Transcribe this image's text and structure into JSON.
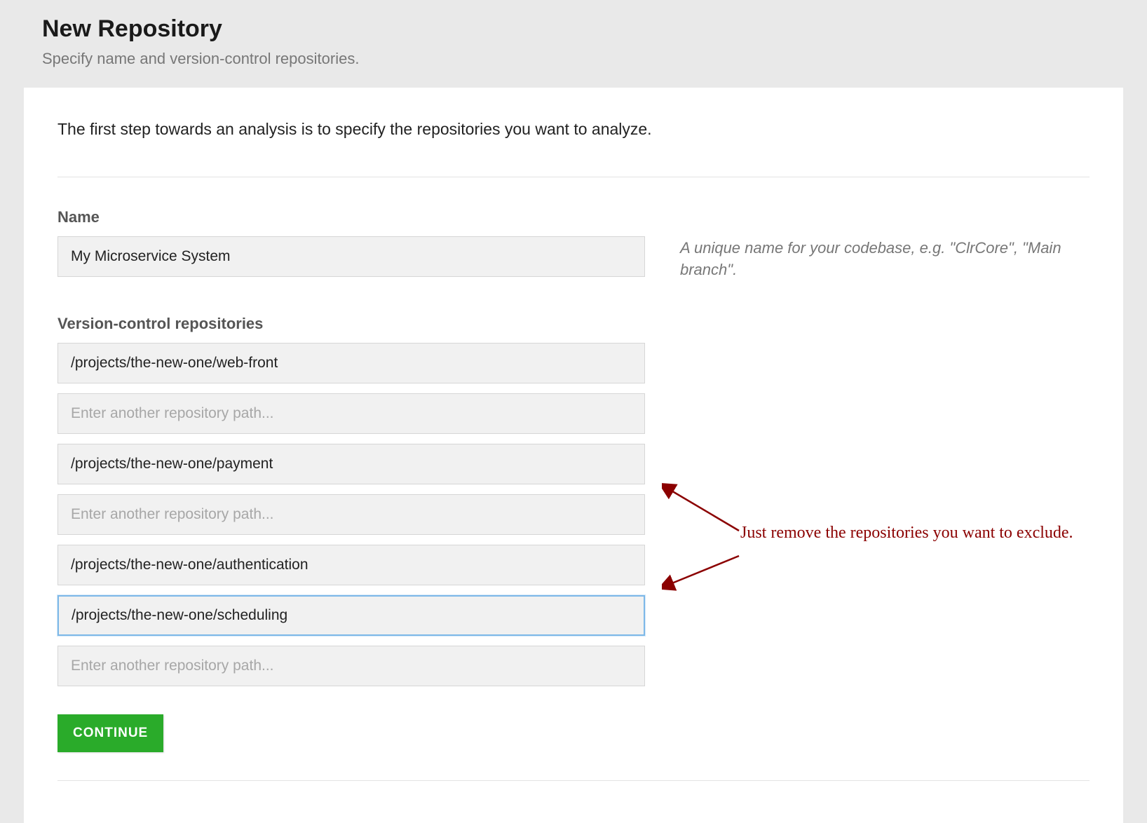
{
  "header": {
    "title": "New Repository",
    "subtitle": "Specify name and version-control repositories."
  },
  "intro": "The first step towards an analysis is to specify the repositories you want to analyze.",
  "nameField": {
    "label": "Name",
    "value": "My Microservice System",
    "helper": "A unique name for your codebase, e.g. \"ClrCore\", \"Main branch\"."
  },
  "reposField": {
    "label": "Version-control repositories",
    "placeholder": "Enter another repository path...",
    "items": [
      {
        "value": "/projects/the-new-one/web-front",
        "focused": false
      },
      {
        "value": "",
        "focused": false
      },
      {
        "value": "/projects/the-new-one/payment",
        "focused": false
      },
      {
        "value": "",
        "focused": false
      },
      {
        "value": "/projects/the-new-one/authentication",
        "focused": false
      },
      {
        "value": "/projects/the-new-one/scheduling",
        "focused": true
      },
      {
        "value": "",
        "focused": false
      }
    ]
  },
  "continueLabel": "CONTINUE",
  "annotation": {
    "text": "Just remove the repositories you want to exclude.",
    "color": "#8b0000"
  }
}
